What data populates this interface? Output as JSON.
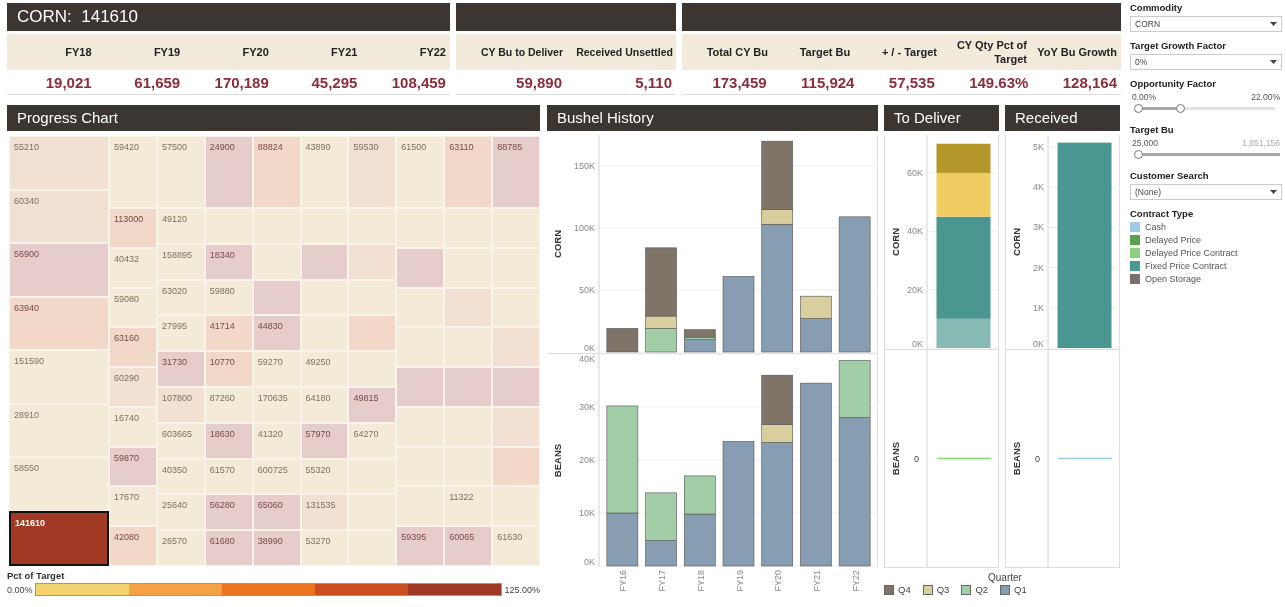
{
  "kpi_panels": [
    {
      "title": "CORN:  141610",
      "columns": [
        {
          "header": "FY18",
          "value": "19,021"
        },
        {
          "header": "FY19",
          "value": "61,659"
        },
        {
          "header": "FY20",
          "value": "170,189"
        },
        {
          "header": "FY21",
          "value": "45,295"
        },
        {
          "header": "FY22",
          "value": "108,459"
        }
      ]
    },
    {
      "columns": [
        {
          "header": "CY Bu to Deliver",
          "value": "59,890"
        },
        {
          "header": "Received Unsettled",
          "value": "5,110"
        }
      ]
    },
    {
      "columns": [
        {
          "header": "Total CY Bu",
          "value": "173,459"
        },
        {
          "header": "Target Bu",
          "value": "115,924"
        },
        {
          "header": "+ / - Target",
          "value": "57,535"
        },
        {
          "header": "CY Qty Pct of Target",
          "value": "149.63%"
        },
        {
          "header": "YoY Bu Growth",
          "value": "128,164"
        }
      ]
    }
  ],
  "progress_chart": {
    "title": "Progress Chart",
    "treemap": {
      "left_column": [
        {
          "label": "55210",
          "color": "#f2e1d2",
          "selected": false
        },
        {
          "label": "60340",
          "color": "#f2e1d2",
          "selected": false
        },
        {
          "label": "56900",
          "color": "#e6cdcb",
          "selected": false
        },
        {
          "label": "63940",
          "color": "#f2d8c8",
          "selected": false
        },
        {
          "label": "151590",
          "color": "#f3ebd8",
          "selected": false
        },
        {
          "label": "28910",
          "color": "#f3ebd8",
          "selected": false
        },
        {
          "label": "58550",
          "color": "#f3ebd8",
          "selected": false
        },
        {
          "label": "141610",
          "color": "#a03a24",
          "selected": true
        }
      ],
      "top_row": [
        {
          "label": "59420",
          "color": "#f3ebd8",
          "selected": false
        },
        {
          "label": "57500",
          "color": "#f3ebd8",
          "selected": false
        },
        {
          "label": "24900",
          "color": "#e6cdcb",
          "selected": false
        },
        {
          "label": "88824",
          "color": "#f2d8c8",
          "selected": false
        },
        {
          "label": "43890",
          "color": "#f3ebd8",
          "selected": false
        },
        {
          "label": "59530",
          "color": "#f2e1d2",
          "selected": false
        },
        {
          "label": "61500",
          "color": "#f3ebd8",
          "selected": false
        },
        {
          "label": "63110",
          "color": "#f2d8c8",
          "selected": false
        },
        {
          "label": "88785",
          "color": "#e6cdcb",
          "selected": false
        }
      ],
      "columns": [
        [
          {
            "label": "113000",
            "color": "#f2d8c8",
            "selected": false
          },
          {
            "label": "40432",
            "color": "#f3ebd8",
            "selected": false
          },
          {
            "label": "59080",
            "color": "#f3ebd8",
            "selected": false
          },
          {
            "label": "63160",
            "color": "#f2d8c8",
            "selected": false
          },
          {
            "label": "60290",
            "color": "#f2e1d2",
            "selected": false
          },
          {
            "label": "16740",
            "color": "#f3ebd8",
            "selected": false
          },
          {
            "label": "59870",
            "color": "#e6cdcb",
            "selected": false
          },
          {
            "label": "17670",
            "color": "#f3ebd8",
            "selected": false
          },
          {
            "label": "42080",
            "color": "#f2d8c8",
            "selected": false
          }
        ],
        [
          {
            "label": "49120",
            "color": "#f3ebd8",
            "selected": false
          },
          {
            "label": "158895",
            "color": "#f3ebd8",
            "selected": false
          },
          {
            "label": "63020",
            "color": "#f3ebd8",
            "selected": false
          },
          {
            "label": "27995",
            "color": "#f3ebd8",
            "selected": false
          },
          {
            "label": "31730",
            "color": "#e6cdcb",
            "selected": false
          },
          {
            "label": "107800",
            "color": "#f2e1d2",
            "selected": false
          },
          {
            "label": "603665",
            "color": "#f3ebd8",
            "selected": false
          },
          {
            "label": "40350",
            "color": "#f3ebd8",
            "selected": false
          },
          {
            "label": "25640",
            "color": "#f3ebd8",
            "selected": false
          },
          {
            "label": "26570",
            "color": "#f3ebd8",
            "selected": false
          }
        ],
        [
          {
            "color": "#f3ebd8",
            "selected": false
          },
          {
            "label": "18340",
            "color": "#e6cdcb",
            "selected": false
          },
          {
            "label": "59880",
            "color": "#f3ebd8",
            "selected": false
          },
          {
            "label": "41714",
            "color": "#f2d8c8",
            "selected": false
          },
          {
            "label": "10770",
            "color": "#f2d8c8",
            "selected": false
          },
          {
            "label": "87260",
            "color": "#f3ebd8",
            "selected": false
          },
          {
            "label": "18630",
            "color": "#e6cdcb",
            "selected": false
          },
          {
            "label": "61570",
            "color": "#f3ebd8",
            "selected": false
          },
          {
            "label": "56280",
            "color": "#e6cdcb",
            "selected": false
          },
          {
            "label": "61680",
            "color": "#e6cdcb",
            "selected": false
          }
        ],
        [
          {
            "color": "#f3ebd8",
            "selected": false
          },
          {
            "color": "#f3ebd8",
            "selected": false
          },
          {
            "color": "#e6cdcb",
            "selected": false
          },
          {
            "label": "44830",
            "color": "#e6cdcb",
            "selected": false
          },
          {
            "label": "59270",
            "color": "#f3ebd8",
            "selected": false
          },
          {
            "label": "170635",
            "color": "#f3ebd8",
            "selected": false
          },
          {
            "label": "41320",
            "color": "#f3ebd8",
            "selected": false
          },
          {
            "label": "600725",
            "color": "#f3ebd8",
            "selected": false
          },
          {
            "label": "65060",
            "color": "#e6cdcb",
            "selected": false
          },
          {
            "label": "38990",
            "color": "#e6cdcb",
            "selected": false
          }
        ],
        [
          {
            "color": "#f3ebd8",
            "selected": false
          },
          {
            "color": "#e6cdcb",
            "selected": false
          },
          {
            "color": "#f3ebd8",
            "selected": false
          },
          {
            "color": "#f3ebd8",
            "selected": false
          },
          {
            "label": "49250",
            "color": "#f3ebd8",
            "selected": false
          },
          {
            "label": "64180",
            "color": "#f3ebd8",
            "selected": false
          },
          {
            "label": "57970",
            "color": "#e6cdcb",
            "selected": false
          },
          {
            "label": "55320",
            "color": "#f3ebd8",
            "selected": false
          },
          {
            "label": "131535",
            "color": "#f2e1d2",
            "selected": false
          },
          {
            "label": "53270",
            "color": "#f3ebd8",
            "selected": false
          }
        ],
        [
          {
            "color": "#f3ebd8",
            "selected": false
          },
          {
            "color": "#f2e1d2",
            "selected": false
          },
          {
            "color": "#f3ebd8",
            "selected": false
          },
          {
            "color": "#f2d8c8",
            "selected": false
          },
          {
            "color": "#f3ebd8",
            "selected": false
          },
          {
            "label": "49815",
            "color": "#e6cdcb",
            "selected": false
          },
          {
            "label": "64270",
            "color": "#f3ebd8",
            "selected": false
          },
          {
            "color": "#f3ebd8",
            "selected": false
          },
          {
            "color": "#f3ebd8",
            "selected": false
          },
          {
            "color": "#f3ebd8",
            "selected": false
          }
        ],
        [
          {
            "color": "#f3ebd8",
            "selected": false
          },
          {
            "color": "#e6cdcb",
            "selected": false
          },
          {
            "color": "#f3ebd8",
            "selected": false
          },
          {
            "color": "#f3ebd8",
            "selected": false
          },
          {
            "color": "#e6cdcb",
            "selected": false
          },
          {
            "color": "#f3ebd8",
            "selected": false
          },
          {
            "color": "#f3ebd8",
            "selected": false
          },
          {
            "color": "#f3ebd8",
            "selected": false
          },
          {
            "label": "59395",
            "color": "#e6cdcb",
            "selected": false
          }
        ],
        [
          {
            "color": "#f3ebd8",
            "selected": false
          },
          {
            "color": "#f3ebd8",
            "selected": false
          },
          {
            "color": "#f2e1d2",
            "selected": false
          },
          {
            "color": "#f3ebd8",
            "selected": false
          },
          {
            "color": "#e6cdcb",
            "selected": false
          },
          {
            "color": "#f3ebd8",
            "selected": false
          },
          {
            "color": "#f3ebd8",
            "selected": false
          },
          {
            "label": "11322",
            "color": "#f3ebd8",
            "selected": false
          },
          {
            "label": "60065",
            "color": "#e6cdcb",
            "selected": false
          }
        ],
        [
          {
            "color": "#f3ebd8",
            "selected": false
          },
          {
            "color": "#f3ebd8",
            "selected": false
          },
          {
            "color": "#f3ebd8",
            "selected": false
          },
          {
            "color": "#f2e1d2",
            "selected": false
          },
          {
            "color": "#e6cdcb",
            "selected": false
          },
          {
            "color": "#f2e1d2",
            "selected": false
          },
          {
            "color": "#f2d8c8",
            "selected": false
          },
          {
            "color": "#f3ebd8",
            "selected": false
          },
          {
            "label": "61630",
            "color": "#f3ebd8",
            "selected": false
          }
        ]
      ]
    },
    "legend": {
      "title": "Pct of Target",
      "min_label": "0.00%",
      "max_label": "125.00%",
      "steps": [
        {
          "color": "#f2d36d"
        },
        {
          "color": "#f5a247"
        },
        {
          "color": "#ec731f"
        },
        {
          "color": "#cb4e21"
        },
        {
          "color": "#9e3a26"
        }
      ]
    }
  },
  "bushel_history": {
    "title": "Bushel History",
    "x_labels": [
      "FY16",
      "FY17",
      "FY18",
      "FY19",
      "FY20",
      "FY21",
      "FY22"
    ],
    "corn": {
      "chart_data": {
        "type": "bar",
        "stacked": true,
        "grid": true,
        "ylabel": "CORN",
        "ylim": [
          0,
          175000
        ],
        "yticks": [
          {
            "value": 0,
            "label": "0K"
          },
          {
            "value": 50000,
            "label": "50K"
          },
          {
            "value": 100000,
            "label": "100K"
          },
          {
            "value": 150000,
            "label": "150K"
          }
        ],
        "series": [
          {
            "name": "Q1",
            "color": "#879db1",
            "values": [
              0,
              0,
              10000,
              61000,
              103000,
              27000,
              109000
            ]
          },
          {
            "name": "Q2",
            "color": "#a1cea6",
            "values": [
              0,
              19000,
              2000,
              0,
              0,
              0,
              0
            ]
          },
          {
            "name": "Q3",
            "color": "#d9cf9e",
            "values": [
              0,
              10000,
              0,
              0,
              12000,
              18000,
              0
            ]
          },
          {
            "name": "Q4",
            "color": "#7f7468",
            "values": [
              19000,
              55000,
              6000,
              0,
              55000,
              0,
              0
            ]
          }
        ]
      }
    },
    "beans": {
      "chart_data": {
        "type": "bar",
        "stacked": true,
        "grid": true,
        "ylabel": "BEANS",
        "ylim": [
          0,
          40000
        ],
        "yticks": [
          {
            "value": 0,
            "label": "0K"
          },
          {
            "value": 10000,
            "label": "10K"
          },
          {
            "value": 20000,
            "label": "20K"
          },
          {
            "value": 30000,
            "label": "30K"
          },
          {
            "value": 40000,
            "label": "40K"
          }
        ],
        "series": [
          {
            "color": "#879db1",
            "values": [
              10000,
              4800,
              9800,
              23500,
              23300,
              34500,
              28000
            ]
          },
          {
            "color": "#a1cea6",
            "values": [
              20200,
              9000,
              7200,
              0,
              0,
              0,
              10800
            ]
          },
          {
            "color": "#d9cf9e",
            "values": [
              0,
              0,
              0,
              0,
              3400,
              0,
              0
            ]
          },
          {
            "color": "#7f7468",
            "values": [
              0,
              0,
              0,
              0,
              9300,
              0,
              0
            ]
          }
        ]
      }
    }
  },
  "to_deliver": {
    "title": "To Deliver",
    "corn": {
      "chart_data": {
        "type": "bar",
        "stacked": true,
        "grid": true,
        "ylabel": "CORN",
        "ylim": [
          0,
          73000
        ],
        "yticks": [
          {
            "value": 0,
            "label": "0K"
          },
          {
            "value": 20000,
            "label": "20K"
          },
          {
            "value": 40000,
            "label": "40K"
          },
          {
            "value": 60000,
            "label": "60K"
          }
        ],
        "series": [
          {
            "color": "#86bab3",
            "values": [
              10000
            ]
          },
          {
            "color": "#4a9690",
            "values": [
              35000
            ]
          },
          {
            "color": "#f0cd63",
            "values": [
              15000
            ]
          },
          {
            "color": "#b4982b",
            "values": [
              10000
            ]
          }
        ]
      }
    },
    "beans": {
      "axis_title": "BEANS",
      "zero_label": "0",
      "color": "#8cd17d"
    }
  },
  "received": {
    "title": "Received",
    "corn": {
      "chart_data": {
        "type": "bar",
        "grid": true,
        "ylabel": "CORN",
        "ylim": [
          0,
          5300
        ],
        "yticks": [
          {
            "value": 0,
            "label": "0K"
          },
          {
            "value": 1000,
            "label": "1K"
          },
          {
            "value": 2000,
            "label": "2K"
          },
          {
            "value": 3000,
            "label": "3K"
          },
          {
            "value": 4000,
            "label": "4K"
          },
          {
            "value": 5000,
            "label": "5K"
          }
        ],
        "series": [
          {
            "color": "#4a9690",
            "values": [
              5110
            ]
          }
        ]
      }
    },
    "beans": {
      "axis_title": "BEANS",
      "zero_label": "0",
      "color": "#9fcbe8"
    }
  },
  "quarter_legend": {
    "title": "Quarter"
  },
  "filters": [
    {
      "kind": "dropdown",
      "label": "Commodity",
      "value": "CORN"
    },
    {
      "kind": "dropdown",
      "label": "Target Growth Factor",
      "value": "0%"
    },
    {
      "kind": "range",
      "label": "Opportunity Factor",
      "min_label": "0.00%",
      "max_label": "22.00%",
      "thumbs": [
        {
          "level": 0
        },
        {
          "level": 0.29
        }
      ]
    },
    {
      "kind": "slider",
      "label": "Target Bu",
      "min_label": "25,000",
      "max_label": "1,851,156",
      "level": 0
    },
    {
      "kind": "dropdown",
      "label": "Customer Search",
      "value": "(None)"
    }
  ],
  "contract_type": {
    "title": "Contract Type",
    "items": [
      {
        "label": "Cash",
        "color": "#9fcbe8"
      },
      {
        "label": "Delayed Price",
        "color": "#59a14f"
      },
      {
        "label": "Delayed Price Contract",
        "color": "#8cd17d"
      },
      {
        "label": "Fixed Price Contract",
        "color": "#499894"
      },
      {
        "label": "Open Storage",
        "color": "#79706e"
      }
    ]
  }
}
